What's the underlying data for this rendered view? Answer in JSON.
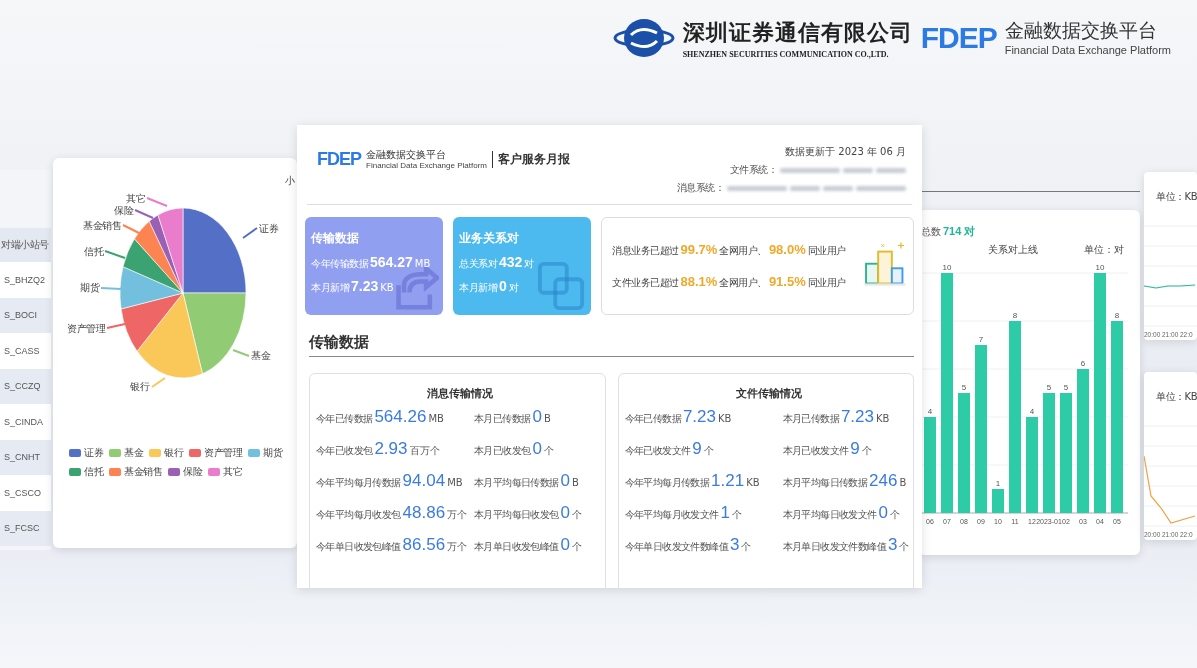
{
  "brand": {
    "company_cn": "深圳证券通信有限公司",
    "company_en": "SHENZHEN SECURITIES COMMUNICATION CO.,LTD.",
    "platform_mark": "FDEP",
    "platform_cn": "金融数据交换平台",
    "platform_en": "Financial Data Exchange Platform"
  },
  "station_table": {
    "header": "对端小站号",
    "rows": [
      "S_BHZQ2",
      "S_BOCI",
      "S_CASS",
      "S_CCZQ",
      "S_CINDA",
      "S_CNHT",
      "S_CSCO",
      "S_FCSC"
    ]
  },
  "pie_panel": {
    "title": "小",
    "pie_labels": [
      {
        "label": "其它",
        "color": "#ea7ccc"
      },
      {
        "label": "保险",
        "color": "#9a60b4"
      },
      {
        "label": "基金销售",
        "color": "#fc8452"
      },
      {
        "label": "证券",
        "color": "#5470c6"
      },
      {
        "label": "信托",
        "color": "#3ba272"
      },
      {
        "label": "期货",
        "color": "#73c0de"
      },
      {
        "label": "资产管理",
        "color": "#ee6666"
      },
      {
        "label": "基金",
        "color": "#91cc75"
      },
      {
        "label": "银行",
        "color": "#fac858"
      }
    ],
    "legend": [
      {
        "label": "证券",
        "color": "#5470c6"
      },
      {
        "label": "基金",
        "color": "#91cc75"
      },
      {
        "label": "银行",
        "color": "#fac858"
      },
      {
        "label": "资产管理",
        "color": "#ee6666"
      },
      {
        "label": "期货",
        "color": "#73c0de"
      },
      {
        "label": "信托",
        "color": "#3ba272"
      },
      {
        "label": "基金销售",
        "color": "#fc8452"
      },
      {
        "label": "保险",
        "color": "#9a60b4"
      },
      {
        "label": "其它",
        "color": "#ea7ccc"
      }
    ]
  },
  "report": {
    "logo_mark": "FDEP",
    "logo_cn": "金融数据交换平台",
    "logo_en": "Financial Data Exchange Platform",
    "title": "客户服务月报",
    "updated": "数据更新于 2023 年 06 月",
    "systems": [
      "文件系统：",
      "消息系统："
    ],
    "summary_cards": [
      {
        "kind": "transfer",
        "title": "传输数据",
        "lines": [
          {
            "label": "今年传输数据",
            "value": "564.27",
            "unit": "MB"
          },
          {
            "label": "本月新增",
            "value": "7.23",
            "unit": "KB"
          }
        ]
      },
      {
        "kind": "relation",
        "title": "业务关系对",
        "lines": [
          {
            "label": "总关系对",
            "value": "432",
            "unit": "对"
          },
          {
            "label": "本月新增",
            "value": "0",
            "unit": "对"
          }
        ]
      }
    ],
    "ranking": [
      {
        "lead": "消息业务已超过",
        "all_pct": "99.7%",
        "all_label": "全网用户、",
        "peer_pct": "98.0%",
        "peer_label": "同业用户"
      },
      {
        "lead": "文件业务已超过",
        "all_pct": "88.1%",
        "all_label": "全网用户、",
        "peer_pct": "91.5%",
        "peer_label": "同业用户"
      }
    ],
    "section_title": "传输数据",
    "panels": [
      {
        "title": "消息传输情况",
        "cells": [
          {
            "label": "今年已传数据",
            "value": "564.26",
            "unit": "MB"
          },
          {
            "label": "本月已传数据",
            "value": "0",
            "unit": "B"
          },
          {
            "label": "今年已收发包",
            "value": "2.93",
            "unit": "百万个"
          },
          {
            "label": "本月已收发包",
            "value": "0",
            "unit": "个"
          },
          {
            "label": "今年平均每月传数据",
            "value": "94.04",
            "unit": "MB"
          },
          {
            "label": "本月平均每日传数据",
            "value": "0",
            "unit": "B"
          },
          {
            "label": "今年平均每月收发包",
            "value": "48.86",
            "unit": "万个"
          },
          {
            "label": "本月平均每日收发包",
            "value": "0",
            "unit": "个"
          },
          {
            "label": "今年单日收发包峰值",
            "value": "86.56",
            "unit": "万个"
          },
          {
            "label": "本月单日收发包峰值",
            "value": "0",
            "unit": "个"
          }
        ]
      },
      {
        "title": "文件传输情况",
        "cells": [
          {
            "label": "今年已传数据",
            "value": "7.23",
            "unit": "KB"
          },
          {
            "label": "本月已传数据",
            "value": "7.23",
            "unit": "KB"
          },
          {
            "label": "今年已收发文件",
            "value": "9",
            "unit": "个"
          },
          {
            "label": "本月已收发文件",
            "value": "9",
            "unit": "个"
          },
          {
            "label": "今年平均每月传数据",
            "value": "1.21",
            "unit": "KB"
          },
          {
            "label": "本月平均每日传数据",
            "value": "246",
            "unit": "B"
          },
          {
            "label": "今年平均每月收发文件",
            "value": "1",
            "unit": "个"
          },
          {
            "label": "本月平均每日收发文件",
            "value": "0",
            "unit": "个"
          },
          {
            "label": "今年单日收发文件数峰值",
            "value": "3",
            "unit": "个"
          },
          {
            "label": "本月单日收发文件数峰值",
            "value": "3",
            "unit": "个"
          }
        ]
      }
    ]
  },
  "relation_chart": {
    "total_label": "总数",
    "total_value": "714 对",
    "title": "关系对上线",
    "unit": "单位：对",
    "chart_data": {
      "type": "bar",
      "categories": [
        "06",
        "07",
        "08",
        "09",
        "10",
        "11",
        "12",
        "2023-01",
        "02",
        "03",
        "04",
        "05"
      ],
      "series": [
        {
          "color": "#2ecba7",
          "values": [
            4,
            10,
            5,
            7,
            1,
            8,
            4,
            5,
            5,
            6,
            10,
            8
          ]
        }
      ],
      "ylim": [
        0,
        10
      ],
      "data_labels": true
    }
  },
  "side_panels": [
    {
      "kind": "flat",
      "color": "#2bb59a",
      "unit": "单位：KB",
      "ticks": [
        "20:00",
        "21:00",
        "22:0"
      ]
    },
    {
      "kind": "falling",
      "color": "#f0a040",
      "unit": "单位：KB",
      "ticks": [
        "20:00",
        "21:00",
        "22:0"
      ]
    }
  ]
}
